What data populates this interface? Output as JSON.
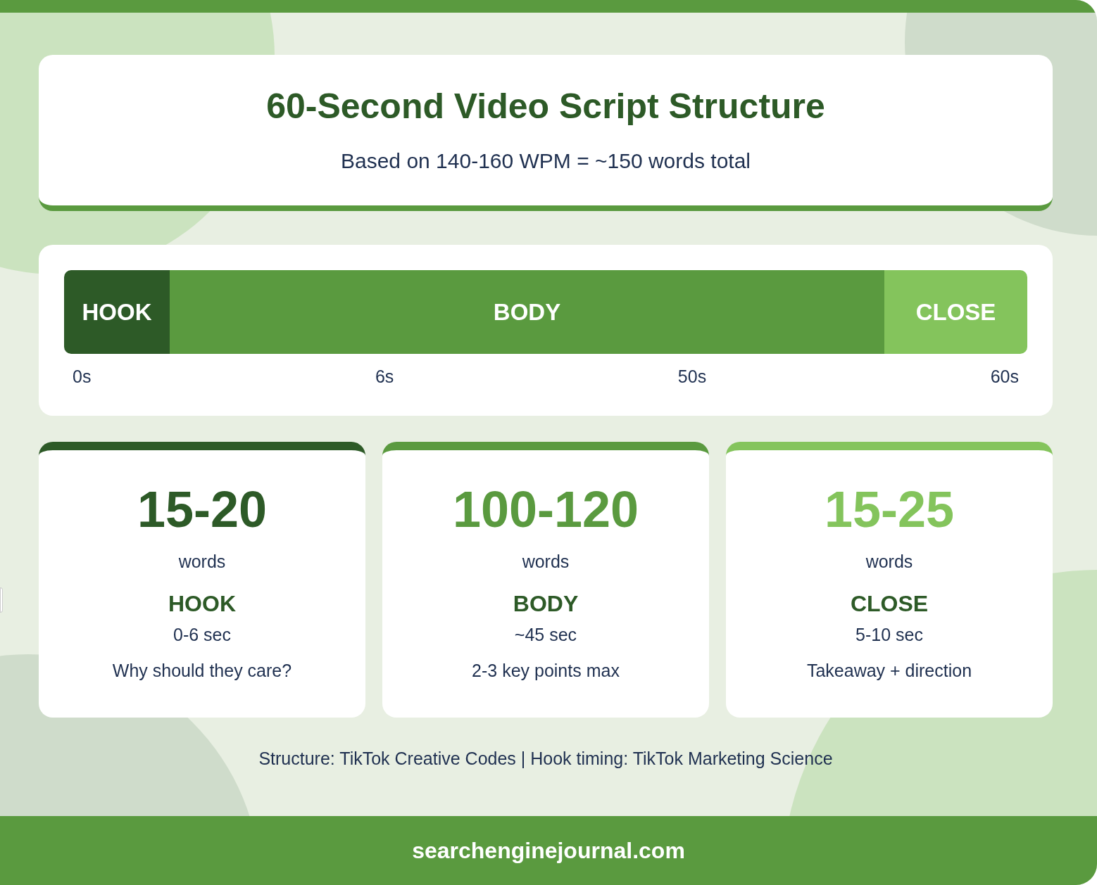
{
  "header": {
    "title": "60-Second Video Script Structure",
    "subtitle": "Based on 140-160 WPM = ~150 words total"
  },
  "timeline": {
    "segments": [
      {
        "label": "HOOK",
        "color": "#2d5a27"
      },
      {
        "label": "BODY",
        "color": "#5a9a3f"
      },
      {
        "label": "CLOSE",
        "color": "#84c45c"
      }
    ],
    "ticks": [
      "0s",
      "6s",
      "50s",
      "60s"
    ]
  },
  "cards": [
    {
      "count": "15-20",
      "unit": "words",
      "name": "HOOK",
      "duration": "0-6 sec",
      "purpose": "Why should they care?",
      "color": "#2d5a27"
    },
    {
      "count": "100-120",
      "unit": "words",
      "name": "BODY",
      "duration": "~45 sec",
      "purpose": "2-3 key points max",
      "color": "#5a9a3f"
    },
    {
      "count": "15-25",
      "unit": "words",
      "name": "CLOSE",
      "duration": "5-10 sec",
      "purpose": "Takeaway + direction",
      "color": "#84c45c"
    }
  ],
  "source": "Structure: TikTok Creative Codes | Hook timing: TikTok Marketing Science",
  "footer": "searchenginejournal.com"
}
